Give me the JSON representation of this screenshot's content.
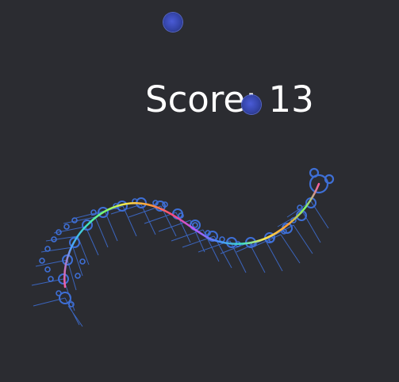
{
  "hud": {
    "score_label": "Score: 13"
  },
  "colors": {
    "background": "#2b2c31",
    "creature_outline": "#3e6fd6",
    "orb_fill": "#3444a8",
    "spine_gradient": [
      "#ff5aa0",
      "#4aa3ff",
      "#3ee0c8",
      "#7cff6a",
      "#ffe84a",
      "#ff9a3a",
      "#ff4a7a",
      "#b45aff",
      "#4a8cff",
      "#3ee0c8",
      "#7cff6a",
      "#ffe84a",
      "#ff5aa0"
    ]
  },
  "icons": {
    "orb": "sphere-orb",
    "creature_head": "head-with-ears",
    "creature_segment": "leg-joint-circle"
  }
}
